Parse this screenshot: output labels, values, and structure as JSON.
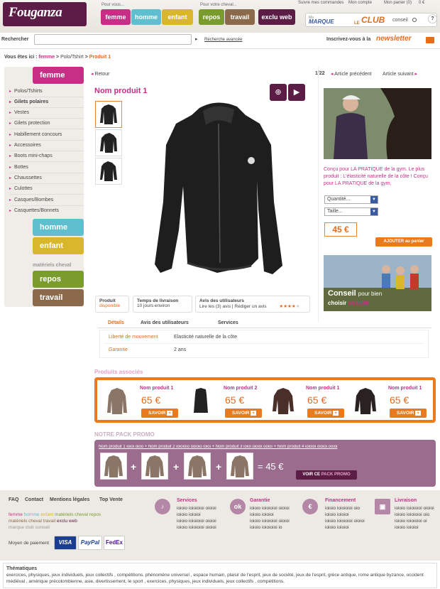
{
  "header": {
    "logo": "Fouganza",
    "pour_vous": "Pour vous...",
    "pour_cheval": "Pour votre cheval...",
    "nav": [
      "femme",
      "homme",
      "enfant",
      "repos",
      "travail",
      "exclu web"
    ],
    "links": [
      "Suivre mes commandes",
      "Mon compte",
      "Mon panier (0)"
    ],
    "cart_amount": "0 €",
    "help": "?",
    "club": {
      "ma": "Ma",
      "marque": "MARQUE",
      "le": "LE",
      "club": "CLUB",
      "conseil": "conseil"
    }
  },
  "search": {
    "label": "Rechercher",
    "go": "▸",
    "advanced": "Recherche avancée",
    "newsletter_label": "Inscrivez-vous à la",
    "newsletter": "newsletter"
  },
  "breadcrumb": {
    "prefix": "Vous êtes ici :",
    "femme": "femme",
    "sep1": ">",
    "section": "Polo/Tshirt",
    "sep2": ">",
    "current": "Produit 1"
  },
  "sidebar": {
    "femme": "femme",
    "items": [
      "Polos/Tshirts",
      "Gilets polaires",
      "Vestes",
      "Gilets protection",
      "Habillement concours",
      "Accessoires",
      "Boots mini-chaps",
      "Bottes",
      "Chaussettes",
      "Culottes",
      "Casques/Bombes",
      "Casquettes/Bonnets"
    ],
    "homme": "homme",
    "enfant": "enfant",
    "materiels": "matériels cheval",
    "repos": "repos",
    "travail": "travail"
  },
  "product": {
    "back": "Retour",
    "pagination": "1/22",
    "prev": "Article précédent",
    "next": "Article suivant",
    "name": "Nom produit 1",
    "description": "Conçu pour LA PRATIQUE de la gym. Le plus produit : L'élasticité naturelle de la côte ! Conçu pour LA PRATIQUE de la gym.",
    "quantity": "Quantité...",
    "size": "Taille...",
    "price": "45 €",
    "add_to_cart": "AJOUTER au panier",
    "conseil_title": "Conseil",
    "conseil_1": "pour bien",
    "conseil_2": "choisir",
    "conseil_3": "sa taille",
    "info": {
      "produit": "Produit",
      "disponible": "disponible",
      "livraison_title": "Temps de livraison",
      "livraison_value": "10 jours environ",
      "avis_title": "Avis des utilisateurs",
      "avis_read": "Lire les (3) avis",
      "avis_write": "Rédiger un avis",
      "rating": 4
    },
    "tabs": [
      "Détails",
      "Avis des utilisateurs",
      "Services"
    ],
    "details": [
      {
        "label": "Liberté de mouvement",
        "value": "Elasticité naturelle de la côte"
      },
      {
        "label": "Garantie",
        "value": "2 ans"
      }
    ]
  },
  "associated": {
    "title": "Produits associés",
    "items": [
      {
        "name": "Nom produit 1",
        "price": "65 €",
        "cta": "SAVOIR"
      },
      {
        "name": "Nom produit 2",
        "price": "65 €",
        "cta": "SAVOIR"
      },
      {
        "name": "Nom produit 1",
        "price": "65 €",
        "cta": "SAVOIR"
      },
      {
        "name": "Nom produit 1",
        "price": "65 €",
        "cta": "SAVOIR"
      }
    ]
  },
  "pack": {
    "title": "NOTRE PACK PROMO",
    "line": "Nom produit 1 ioioi oioo + Nom produit 2 ioioioio ooioio ioioi + Nom produit 3 ioioi oioioi ooioi + Nom produit 4 ioioioi oioioi ooioi",
    "total": "= 45 €",
    "cta_1": "VOIR CE",
    "cta_2": "PACK PROMO"
  },
  "footer": {
    "links": [
      "FAQ",
      "Contact",
      "Mentions légales",
      "Top Vente"
    ],
    "cats_1": [
      "femme",
      "homme",
      "enfant",
      "matériels cheval repos"
    ],
    "cats_2": [
      "matériels cheval travail",
      "exclu web"
    ],
    "cats_3": [
      "marque",
      "club",
      "conseil"
    ],
    "payment_label": "Moyen de paiement",
    "pay": [
      "VISA",
      "PayPal",
      "FedEx"
    ],
    "blocks": [
      {
        "title": "Services",
        "lines": [
          "ioioio ioioioioi oioioi",
          "ioioio ioioioi",
          "ioioio ioioioioi oioioi",
          "ioioio ioioioioi oioioi"
        ]
      },
      {
        "title": "Garantie",
        "lines": [
          "ioioio ioioioioi oioioi",
          "ioioio ioioioi",
          "ioioio ioioioioi oioioi",
          "ioioio ioioioioi io"
        ]
      },
      {
        "title": "Financement",
        "lines": [
          "ioioio ioioioioi oio",
          "ioioio ioioioi",
          "ioioio ioioioioi oioioi",
          "ioioio ioioioi"
        ]
      },
      {
        "title": "Livraison",
        "lines": [
          "ioioio ioioioioi oioioi",
          "ioioio ioioioioi oio",
          "ioioio ioioioioi oi",
          "ioioio ioioioi"
        ]
      }
    ],
    "thematics_title": "Thématiques",
    "thematics": "exercices, physiques, jeux individuels, jeux collectifs , compétitions. phénomène universel , espace humain, plaisir de l'esprit, jeux de société, jeux de l'esprit, grèce antique, rome antique byzance, occident médiéval , amérique précolombienne, asie, divertissement, le sport , exercices, physiques, jeux individuels, jeux collectifs , compétitions."
  },
  "colors": {
    "pink": "#c72f86",
    "orange": "#ea7a1e",
    "plum": "#5b1c46",
    "mauve": "#9c6c8e"
  }
}
